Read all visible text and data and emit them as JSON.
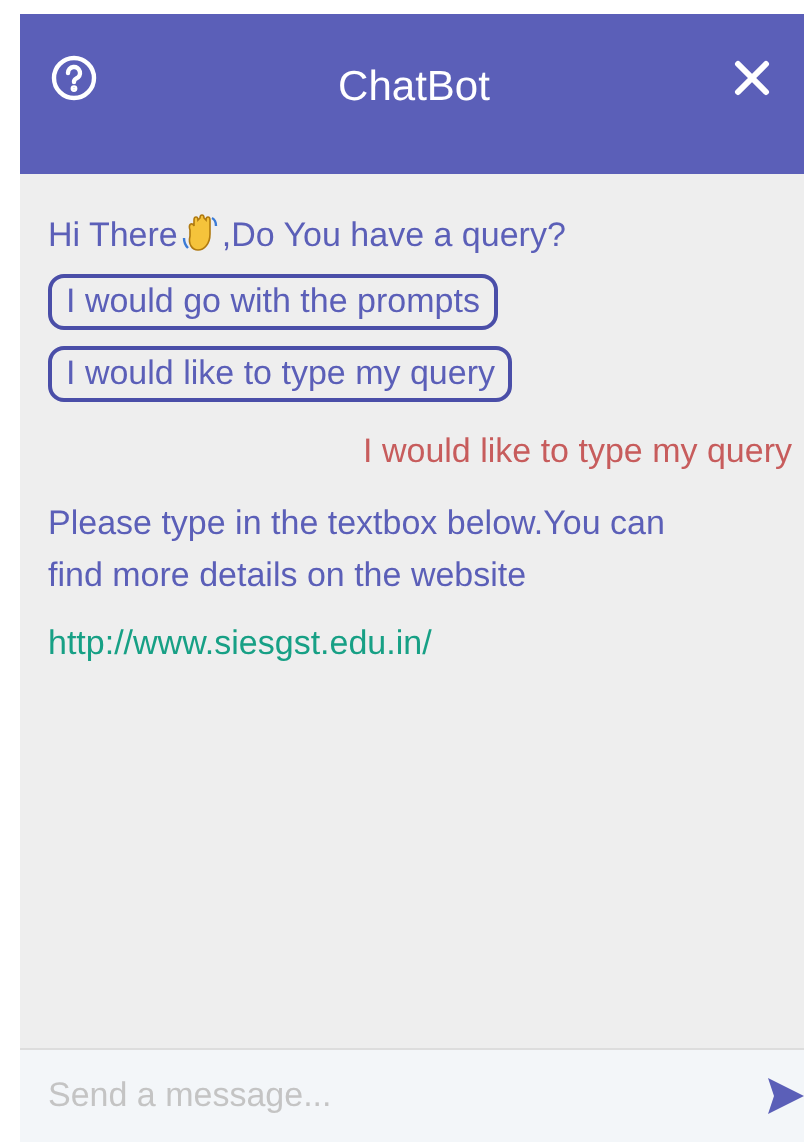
{
  "header": {
    "title": "ChatBot"
  },
  "messages": [
    {
      "kind": "greeting",
      "before": "Hi There",
      "after": ",Do You have a query?"
    },
    {
      "kind": "option",
      "text": "I would go with the prompts"
    },
    {
      "kind": "option",
      "text": "I would like to type my query"
    },
    {
      "kind": "user",
      "text": "I would like to type my query"
    },
    {
      "kind": "bot",
      "text": "Please type in the textbox below.You can find more details on the website"
    },
    {
      "kind": "link",
      "text": "http://www.siesgst.edu.in/"
    }
  ],
  "composer": {
    "placeholder": "Send a message..."
  }
}
